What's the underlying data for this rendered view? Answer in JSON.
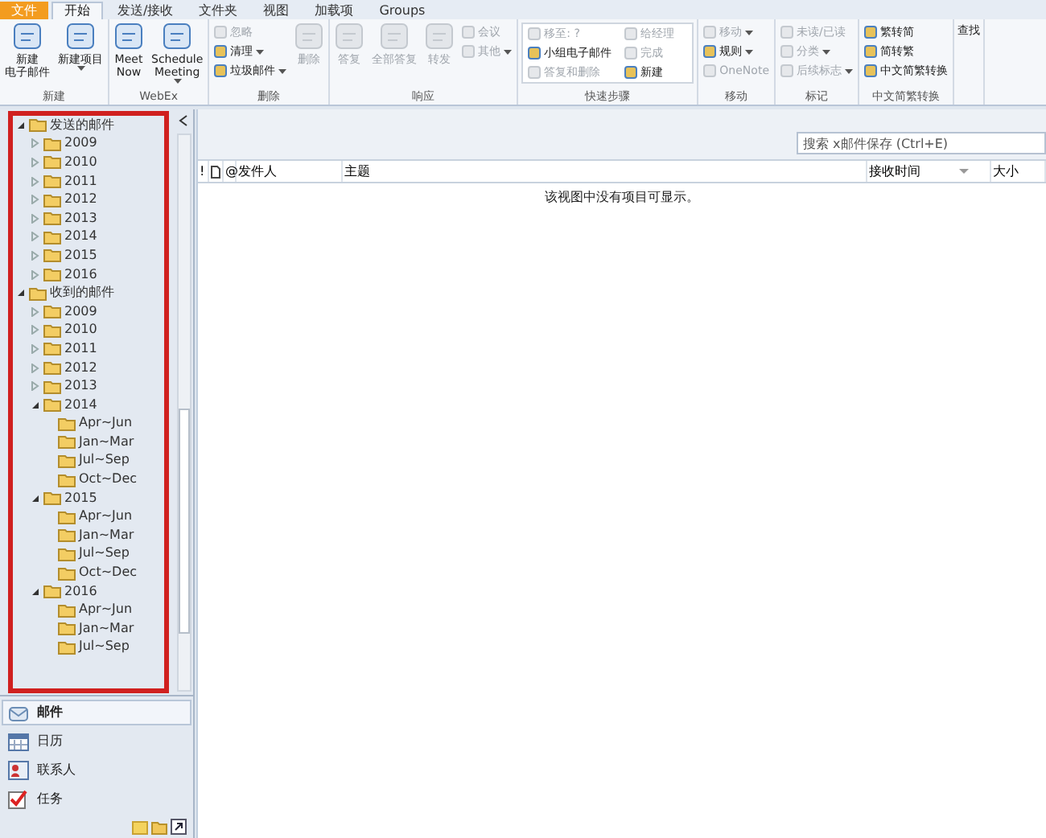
{
  "ribbon_tabs": [
    {
      "label": "文件",
      "kind": "file",
      "selected": false
    },
    {
      "label": "开始",
      "kind": "tab",
      "selected": true
    },
    {
      "label": "发送/接收",
      "kind": "tab",
      "selected": false
    },
    {
      "label": "文件夹",
      "kind": "tab",
      "selected": false
    },
    {
      "label": "视图",
      "kind": "tab",
      "selected": false
    },
    {
      "label": "加载项",
      "kind": "tab",
      "selected": false
    },
    {
      "label": "Groups",
      "kind": "tab",
      "selected": false
    }
  ],
  "ribbon_groups": [
    {
      "label": "新建",
      "kind": "large",
      "items": [
        {
          "lines": [
            "新建",
            "电子邮件"
          ],
          "disabled": false,
          "dropdown": false
        },
        {
          "lines": [
            "新建项目"
          ],
          "disabled": false,
          "dropdown": true
        }
      ]
    },
    {
      "label": "WebEx",
      "kind": "large",
      "items": [
        {
          "lines": [
            "Meet",
            "Now"
          ],
          "disabled": false,
          "dropdown": false
        },
        {
          "lines": [
            "Schedule",
            "Meeting"
          ],
          "disabled": false,
          "dropdown": true
        }
      ]
    },
    {
      "label": "删除",
      "kind": "mixed",
      "items": [
        {
          "label": "忽略",
          "disabled": true,
          "dropdown": false,
          "kind": "small"
        },
        {
          "label": "清理",
          "disabled": false,
          "dropdown": true,
          "kind": "small"
        },
        {
          "label": "垃圾邮件",
          "disabled": false,
          "dropdown": true,
          "kind": "small"
        },
        {
          "label": "删除",
          "disabled": true,
          "dropdown": false,
          "kind": "large"
        }
      ]
    },
    {
      "label": "响应",
      "kind": "mixed",
      "items": [
        {
          "label": "答复",
          "disabled": true,
          "dropdown": false,
          "kind": "large"
        },
        {
          "label": "全部答复",
          "disabled": true,
          "dropdown": false,
          "kind": "large"
        },
        {
          "label": "转发",
          "disabled": true,
          "dropdown": false,
          "kind": "large"
        },
        {
          "label": "会议",
          "disabled": true,
          "dropdown": false,
          "kind": "small"
        },
        {
          "label": "其他",
          "disabled": true,
          "dropdown": true,
          "kind": "small"
        }
      ]
    },
    {
      "label": "快速步骤",
      "kind": "gallery",
      "items": [
        {
          "label": "移至: ?",
          "disabled": true,
          "dropdown": false
        },
        {
          "label": "小组电子邮件",
          "disabled": false,
          "dropdown": false
        },
        {
          "label": "答复和删除",
          "disabled": true,
          "dropdown": false
        },
        {
          "label": "给经理",
          "disabled": true,
          "dropdown": false
        },
        {
          "label": "完成",
          "disabled": true,
          "dropdown": false
        },
        {
          "label": "新建",
          "disabled": false,
          "dropdown": false
        }
      ]
    },
    {
      "label": "移动",
      "kind": "small",
      "items": [
        {
          "label": "移动",
          "disabled": true,
          "dropdown": true
        },
        {
          "label": "规则",
          "disabled": false,
          "dropdown": true
        },
        {
          "label": "OneNote",
          "disabled": true,
          "dropdown": false
        }
      ]
    },
    {
      "label": "标记",
      "kind": "small",
      "items": [
        {
          "label": "未读/已读",
          "disabled": true,
          "dropdown": false
        },
        {
          "label": "分类",
          "disabled": true,
          "dropdown": true
        },
        {
          "label": "后续标志",
          "disabled": true,
          "dropdown": true
        }
      ]
    },
    {
      "label": "中文简繁转换",
      "kind": "small",
      "items": [
        {
          "label": "繁转简",
          "disabled": false,
          "dropdown": false
        },
        {
          "label": "简转繁",
          "disabled": false,
          "dropdown": false
        },
        {
          "label": "中文简繁转换",
          "disabled": false,
          "dropdown": false
        }
      ]
    },
    {
      "kind": "find",
      "items": [
        {
          "label": "查找"
        }
      ]
    }
  ],
  "folders": [
    {
      "label": "发送的邮件",
      "expanded": true,
      "children": [
        {
          "label": "2009",
          "expanded": false
        },
        {
          "label": "2010",
          "expanded": false
        },
        {
          "label": "2011",
          "expanded": false
        },
        {
          "label": "2012",
          "expanded": false
        },
        {
          "label": "2013",
          "expanded": false
        },
        {
          "label": "2014",
          "expanded": false
        },
        {
          "label": "2015",
          "expanded": false
        },
        {
          "label": "2016",
          "expanded": false
        }
      ]
    },
    {
      "label": "收到的邮件",
      "expanded": true,
      "children": [
        {
          "label": "2009",
          "expanded": false
        },
        {
          "label": "2010",
          "expanded": false
        },
        {
          "label": "2011",
          "expanded": false
        },
        {
          "label": "2012",
          "expanded": false
        },
        {
          "label": "2013",
          "expanded": false
        },
        {
          "label": "2014",
          "expanded": true,
          "children": [
            {
              "label": "Apr~Jun"
            },
            {
              "label": "Jan~Mar"
            },
            {
              "label": "Jul~Sep"
            },
            {
              "label": "Oct~Dec"
            }
          ]
        },
        {
          "label": "2015",
          "expanded": true,
          "children": [
            {
              "label": "Apr~Jun"
            },
            {
              "label": "Jan~Mar"
            },
            {
              "label": "Jul~Sep"
            },
            {
              "label": "Oct~Dec"
            }
          ]
        },
        {
          "label": "2016",
          "expanded": true,
          "children": [
            {
              "label": "Apr~Jun"
            },
            {
              "label": "Jan~Mar"
            },
            {
              "label": "Jul~Sep"
            }
          ]
        }
      ]
    }
  ],
  "nav": [
    {
      "label": "邮件",
      "kind": "mail",
      "selected": true
    },
    {
      "label": "日历",
      "kind": "calendar",
      "selected": false
    },
    {
      "label": "联系人",
      "kind": "contacts",
      "selected": false
    },
    {
      "label": "任务",
      "kind": "tasks",
      "selected": false
    }
  ],
  "search": {
    "placeholder": "搜索 x邮件保存 (Ctrl+E)"
  },
  "columns": [
    {
      "label": "!",
      "kind": "text"
    },
    {
      "kind": "doc"
    },
    {
      "label": "@",
      "kind": "text"
    },
    {
      "label": "发件人",
      "kind": "text"
    },
    {
      "label": "主题",
      "kind": "text"
    },
    {
      "label": "接收时间",
      "kind": "sorted"
    },
    {
      "label": "大小",
      "kind": "text"
    }
  ],
  "empty_message": "该视图中没有项目可显示。"
}
